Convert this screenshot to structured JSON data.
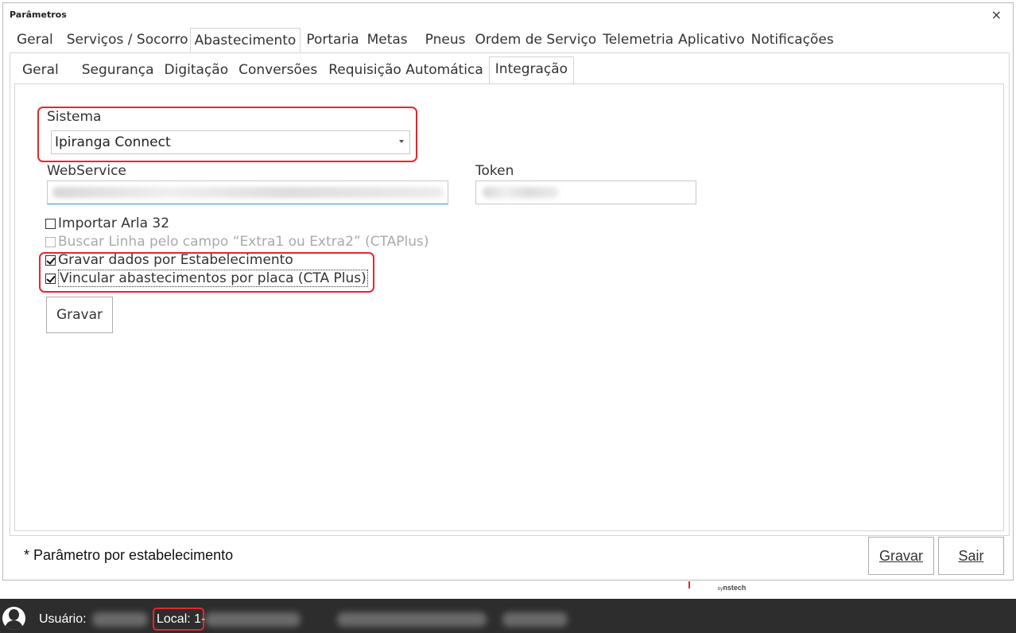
{
  "window": {
    "title": "Parâmetros",
    "close_label": "×"
  },
  "top_tabs": [
    {
      "label": "Geral",
      "active": false
    },
    {
      "label": "Serviços / Socorro",
      "active": false
    },
    {
      "label": "Abastecimento",
      "active": true
    },
    {
      "label": "Portaria",
      "active": false
    },
    {
      "label": "Metas",
      "active": false
    },
    {
      "label": "Pneus",
      "active": false
    },
    {
      "label": "Ordem de Serviço",
      "active": false
    },
    {
      "label": "Telemetria",
      "active": false
    },
    {
      "label": "Aplicativo",
      "active": false
    },
    {
      "label": "Notificações",
      "active": false
    }
  ],
  "sub_tabs": [
    {
      "label": "Geral",
      "active": false
    },
    {
      "label": "Segurança",
      "active": false
    },
    {
      "label": "Digitação",
      "active": false
    },
    {
      "label": "Conversões",
      "active": false
    },
    {
      "label": "Requisição Automática",
      "active": false
    },
    {
      "label": "Integração",
      "active": true
    }
  ],
  "form": {
    "sistema_label": "Sistema",
    "sistema_value": "Ipiranga Connect",
    "webservice_label": "WebService",
    "token_label": "Token",
    "checkboxes": [
      {
        "label": "Importar Arla 32",
        "checked": false,
        "disabled": false
      },
      {
        "label": "Buscar Linha pelo campo “Extra1 ou Extra2” (CTAPlus)",
        "checked": false,
        "disabled": true
      },
      {
        "label": "Gravar dados por Estabelecimento",
        "checked": true,
        "disabled": false
      },
      {
        "label": "Vincular abastecimentos por placa (CTA Plus)",
        "checked": true,
        "disabled": false
      }
    ],
    "save_button": "Gravar"
  },
  "footer": {
    "note": "* Parâmetro por estabelecimento",
    "gravar_button": "Gravar",
    "sair_button": "Sair"
  },
  "brand": {
    "prefix": "by",
    "name": "nstech"
  },
  "statusbar": {
    "user_label": "Usuário:",
    "local_label": "Local: 1-"
  },
  "colors": {
    "highlight": "#e8252f",
    "statusbar_bg": "#2d2d2d"
  }
}
